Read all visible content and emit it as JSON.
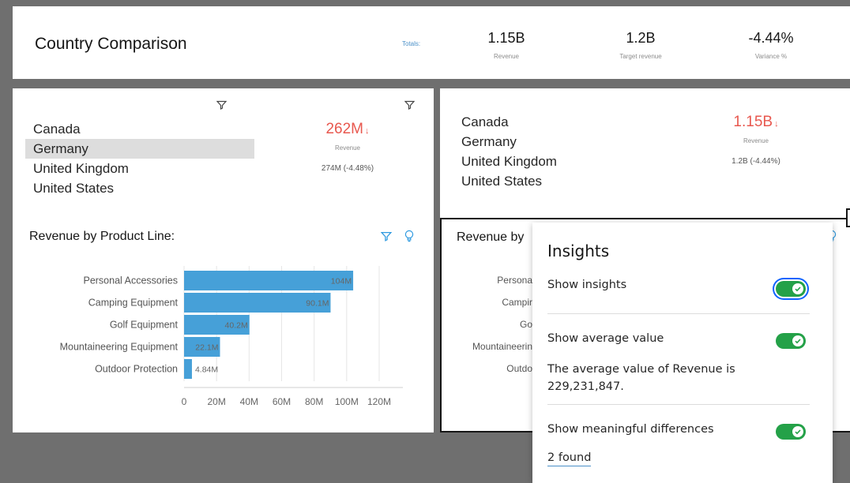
{
  "colors": {
    "background": "#6f6f6f",
    "card": "#ffffff",
    "negative": "#e8584f",
    "bar": "#46a0d8",
    "accent_icon": "#2f9ae0",
    "toggle_on": "#24a148",
    "focus_ring": "#0f62fe"
  },
  "header": {
    "title": "Country Comparison",
    "totals_label": "Totals:",
    "kpis": [
      {
        "value": "1.15B",
        "label": "Revenue"
      },
      {
        "value": "1.2B",
        "label": "Target revenue"
      },
      {
        "value": "-4.44%",
        "label": "Variance %"
      }
    ]
  },
  "left_panel": {
    "countries": [
      "Canada",
      "Germany",
      "United Kingdom",
      "United States"
    ],
    "selected_country": "Germany",
    "kpi": {
      "value": "262M",
      "arrow": "↓",
      "label": "Revenue",
      "comparison": "274M (-4.48%)"
    }
  },
  "right_panel": {
    "countries": [
      "Canada",
      "Germany",
      "United Kingdom",
      "United States"
    ],
    "kpi": {
      "value": "1.15B",
      "arrow": "↓",
      "label": "Revenue",
      "comparison": "1.2B (-4.44%)"
    }
  },
  "left_chart_title": "Revenue by Product Line:",
  "right_chart_title": "Revenue by",
  "right_chart_partial_categories": [
    "Persona",
    "Campir",
    "Go",
    "Mountaineerin",
    "Outdo"
  ],
  "chart_data": {
    "type": "bar",
    "orientation": "horizontal",
    "title": "Revenue by Product Line:",
    "categories": [
      "Personal Accessories",
      "Camping Equipment",
      "Golf Equipment",
      "Mountaineering Equipment",
      "Outdoor Protection"
    ],
    "values": [
      104000000,
      90100000,
      40200000,
      22100000,
      4840000
    ],
    "value_labels": [
      "104M",
      "90.1M",
      "40.2M",
      "22.1M",
      "4.84M"
    ],
    "x_ticks": [
      "0",
      "20M",
      "40M",
      "60M",
      "80M",
      "100M",
      "120M"
    ],
    "xlim": [
      0,
      120000000
    ],
    "grid": true
  },
  "insights": {
    "title": "Insights",
    "show_insights_label": "Show insights",
    "show_average_label": "Show average value",
    "average_text": "The average value of Revenue is 229,231,847.",
    "show_differences_label": "Show meaningful differences",
    "found_link": "2 found"
  }
}
